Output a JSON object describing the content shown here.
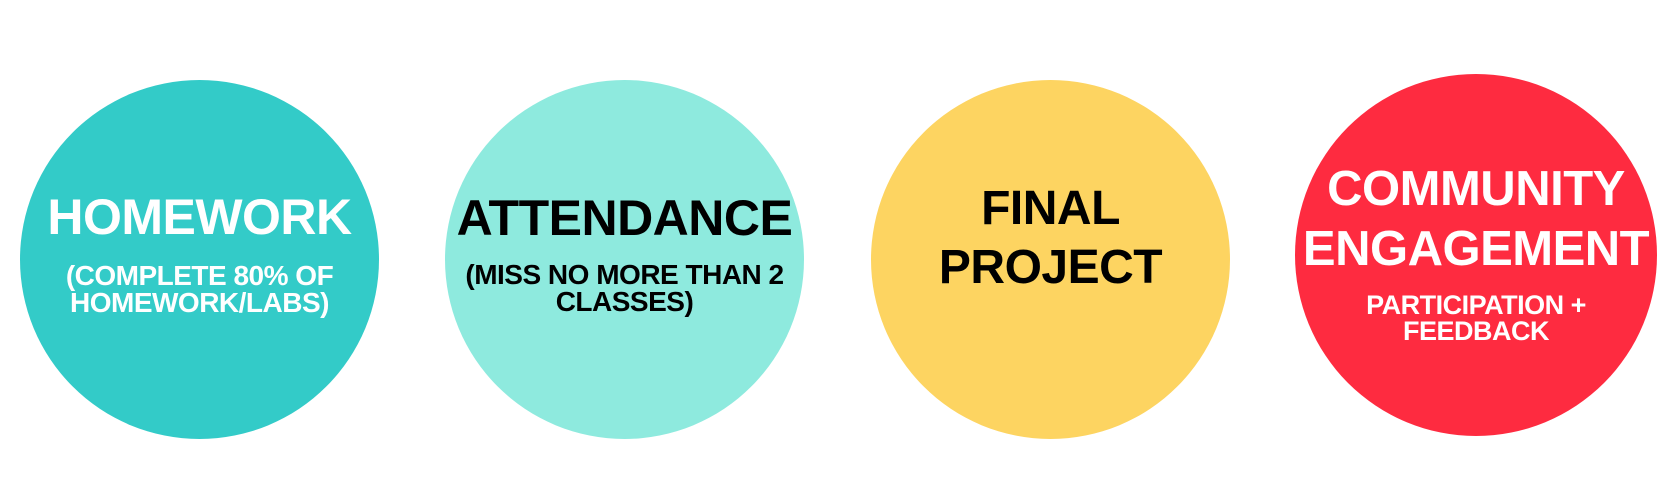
{
  "circles": [
    {
      "title": "HOMEWORK",
      "subtitle_line1": "(COMPLETE 80% OF",
      "subtitle_line2": "HOMEWORK/LABS)",
      "color": "#33cbc8",
      "text_color": "#ffffff"
    },
    {
      "title": "ATTENDANCE",
      "subtitle_line1": "(MISS NO MORE THAN 2",
      "subtitle_line2": "CLASSES)",
      "color": "#8eeade",
      "text_color": "#000000"
    },
    {
      "title_line1": "FINAL",
      "title_line2": "PROJECT",
      "color": "#fdd461",
      "text_color": "#000000"
    },
    {
      "title_line1": "COMMUNITY",
      "title_line2": "ENGAGEMENT",
      "subtitle_line1": "PARTICIPATION +",
      "subtitle_line2": "FEEDBACK",
      "color": "#fe2b40",
      "text_color": "#ffffff"
    }
  ]
}
